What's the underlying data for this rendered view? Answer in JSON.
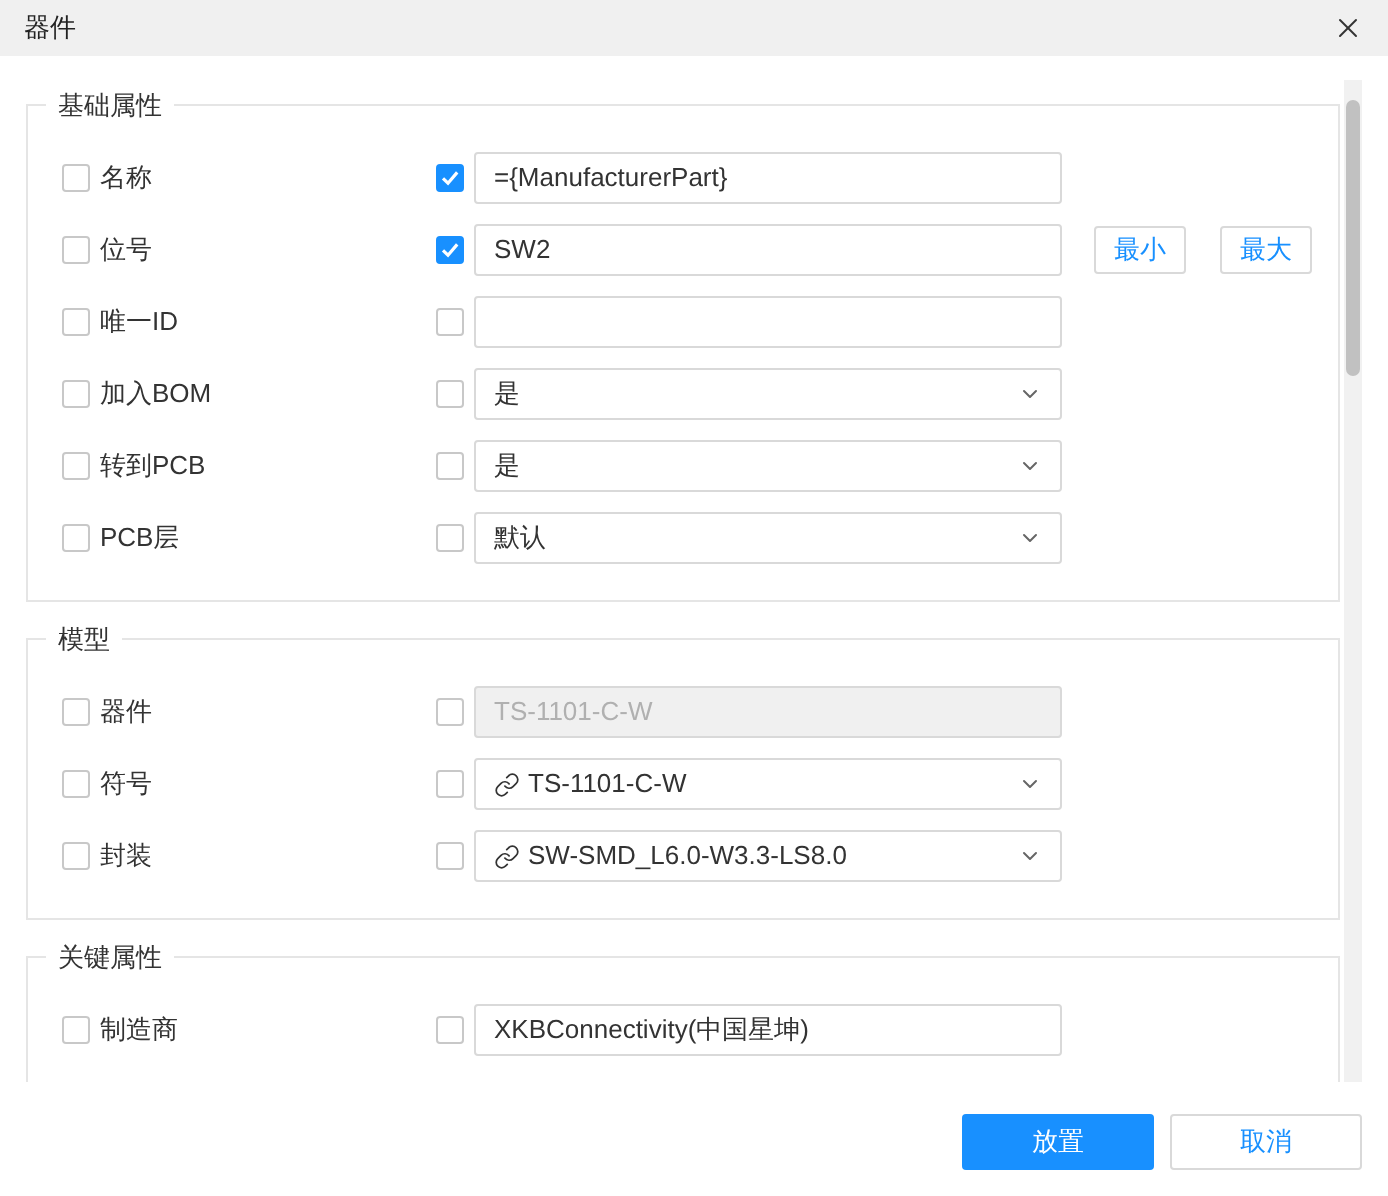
{
  "window": {
    "title": "器件"
  },
  "sections": [
    {
      "title": "基础属性",
      "rows": [
        {
          "label": "名称",
          "checked": false,
          "field_checked": true,
          "kind": "text",
          "value": "={ManufacturerPart}"
        },
        {
          "label": "位号",
          "checked": false,
          "field_checked": true,
          "kind": "text",
          "value": "SW2",
          "buttons": [
            "最小",
            "最大"
          ]
        },
        {
          "label": "唯一ID",
          "checked": false,
          "field_checked": false,
          "kind": "text"
        },
        {
          "label": "加入BOM",
          "checked": false,
          "field_checked": false,
          "kind": "select",
          "value": "是"
        },
        {
          "label": "转到PCB",
          "checked": false,
          "field_checked": false,
          "kind": "select",
          "value": "是"
        },
        {
          "label": "PCB层",
          "checked": false,
          "field_checked": false,
          "kind": "select",
          "value": "默认"
        }
      ]
    },
    {
      "title": "模型",
      "rows": [
        {
          "label": "器件",
          "checked": false,
          "field_checked": false,
          "kind": "text",
          "disabled": true,
          "value": "TS-1101-C-W"
        },
        {
          "label": "符号",
          "checked": false,
          "field_checked": false,
          "kind": "select",
          "linked": true,
          "value": "TS-1101-C-W"
        },
        {
          "label": "封装",
          "checked": false,
          "field_checked": false,
          "kind": "select",
          "linked": true,
          "value": "SW-SMD_L6.0-W3.3-LS8.0"
        }
      ]
    },
    {
      "title": "关键属性",
      "rows": [
        {
          "label": "制造商",
          "checked": false,
          "field_checked": false,
          "kind": "text",
          "value": "XKBConnectivity(中国星坤)"
        }
      ]
    }
  ],
  "footer": {
    "primary": "放置",
    "secondary": "取消"
  }
}
